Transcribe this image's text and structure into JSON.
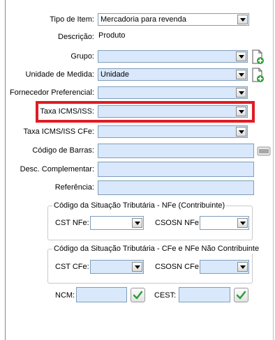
{
  "form": {
    "tipo_item": {
      "label": "Tipo de Item:",
      "value": "Mercadoria para revenda"
    },
    "descricao": {
      "label": "Descrição:",
      "value": "Produto"
    },
    "grupo": {
      "label": "Grupo:",
      "value": ""
    },
    "unidade": {
      "label": "Unidade de Medida:",
      "value": "Unidade"
    },
    "fornecedor": {
      "label": "Fornecedor Preferencial:",
      "value": ""
    },
    "taxa_icms": {
      "label": "Taxa ICMS/ISS:",
      "value": ""
    },
    "taxa_icms_cfe": {
      "label": "Taxa ICMS/ISS CFe:",
      "value": ""
    },
    "codigo_barras": {
      "label": "Código de Barras:",
      "value": ""
    },
    "desc_complementar": {
      "label": "Desc. Complementar:",
      "value": ""
    },
    "referencia": {
      "label": "Referência:",
      "value": ""
    }
  },
  "nfe_group": {
    "title": "Código da Situação Tributária - NFe (Contribuinte)",
    "cst_label": "CST NFe:",
    "csosn_label": "CSOSN NFe:"
  },
  "cfe_group": {
    "title": "Código da Situação Tributária - CFe e NFe Não Contribuinte",
    "cst_label": "CST CFe:",
    "csosn_label": "CSOSN CFe:"
  },
  "bottom": {
    "ncm_label": "NCM:",
    "cest_label": "CEST:"
  },
  "colors": {
    "field_bg": "#d9e8fb",
    "highlight": "#e01b24",
    "check_green": "#2e9e3a"
  },
  "icons": {
    "add_group": "document-add-icon",
    "add_unit": "document-add-icon",
    "barcode": "barcode-icon",
    "ncm_check": "checkmark-icon",
    "cest_check": "checkmark-icon"
  }
}
